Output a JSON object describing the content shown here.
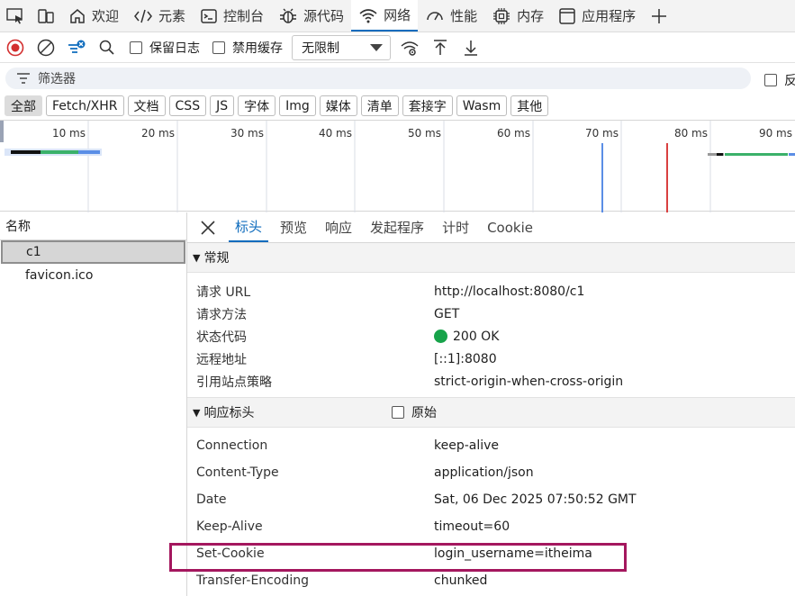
{
  "tabs": [
    {
      "label": "欢迎",
      "icon": "home-icon"
    },
    {
      "label": "元素",
      "icon": "code-icon"
    },
    {
      "label": "控制台",
      "icon": "console-icon"
    },
    {
      "label": "源代码",
      "icon": "bug-icon"
    },
    {
      "label": "网络",
      "icon": "wifi-icon",
      "active": true
    },
    {
      "label": "性能",
      "icon": "gauge-icon"
    },
    {
      "label": "内存",
      "icon": "chip-icon"
    },
    {
      "label": "应用程序",
      "icon": "window-icon"
    }
  ],
  "toolbar": {
    "preserve_log": "保留日志",
    "disable_cache": "禁用缓存",
    "throttling": "无限制"
  },
  "filter": {
    "placeholder": "筛选器",
    "invert": "反"
  },
  "type_chips": [
    "全部",
    "Fetch/XHR",
    "文档",
    "CSS",
    "JS",
    "字体",
    "Img",
    "媒体",
    "清单",
    "套接字",
    "Wasm",
    "其他"
  ],
  "timeline": {
    "ticks": [
      "10 ms",
      "20 ms",
      "30 ms",
      "40 ms",
      "50 ms",
      "60 ms",
      "70 ms",
      "80 ms",
      "90 ms"
    ]
  },
  "request_list": {
    "header": "名称",
    "rows": [
      "c1",
      "favicon.ico"
    ]
  },
  "detail_tabs": [
    "标头",
    "预览",
    "响应",
    "发起程序",
    "计时",
    "Cookie"
  ],
  "general": {
    "title": "常规",
    "rows": [
      {
        "k": "请求 URL",
        "v": "http://localhost:8080/c1"
      },
      {
        "k": "请求方法",
        "v": "GET"
      },
      {
        "k": "状态代码",
        "v": "200 OK"
      },
      {
        "k": "远程地址",
        "v": "[::1]:8080"
      },
      {
        "k": "引用站点策略",
        "v": "strict-origin-when-cross-origin"
      }
    ]
  },
  "response_headers": {
    "title": "响应标头",
    "raw_label": "原始",
    "rows": [
      {
        "k": "Connection",
        "v": "keep-alive"
      },
      {
        "k": "Content-Type",
        "v": "application/json"
      },
      {
        "k": "Date",
        "v": "Sat, 06 Dec 2025 07:50:52 GMT"
      },
      {
        "k": "Keep-Alive",
        "v": "timeout=60"
      },
      {
        "k": "Set-Cookie",
        "v": "login_username=itheima"
      },
      {
        "k": "Transfer-Encoding",
        "v": "chunked"
      }
    ]
  },
  "colors": {
    "accent": "#0f6cbd",
    "record": "#d32f2f",
    "status_ok": "#17a34a",
    "highlight": "#a4175e"
  }
}
